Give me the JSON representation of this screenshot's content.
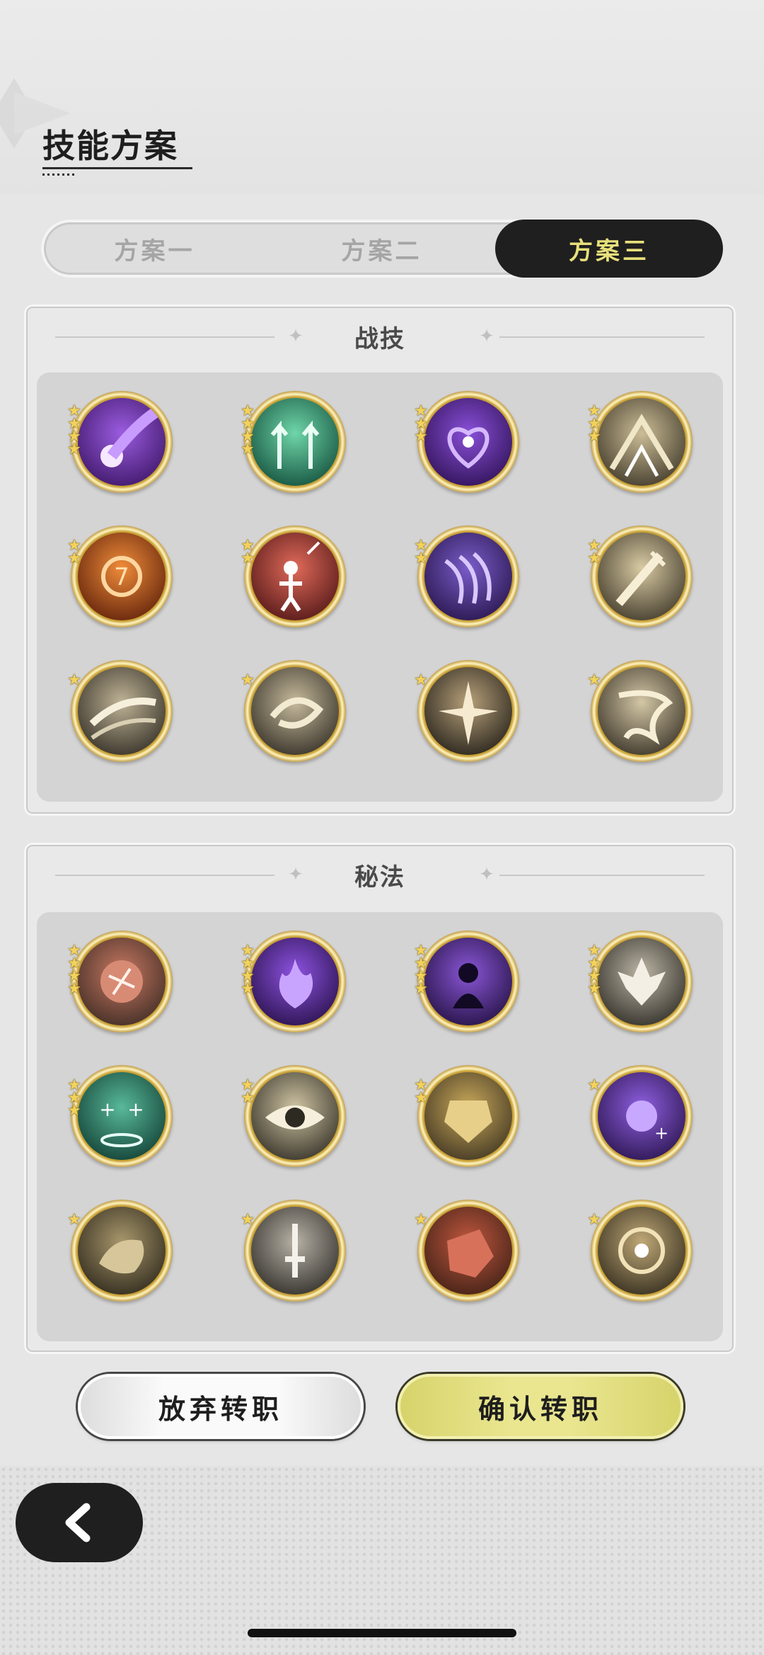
{
  "header": {
    "title": "技能方案"
  },
  "tabs": [
    {
      "label": "方案一",
      "active": false
    },
    {
      "label": "方案二",
      "active": false
    },
    {
      "label": "方案三",
      "active": true
    }
  ],
  "combat_section": {
    "title": "战技",
    "skills": [
      {
        "icon": "purple-comet-skill-icon",
        "stars": 4
      },
      {
        "icon": "green-arrows-up-skill-icon",
        "stars": 4
      },
      {
        "icon": "purple-heart-burst-skill-icon",
        "stars": 3
      },
      {
        "icon": "golden-rays-skill-icon",
        "stars": 3
      },
      {
        "icon": "fire-seal-skill-icon",
        "stars": 2
      },
      {
        "icon": "red-figure-sword-skill-icon",
        "stars": 2
      },
      {
        "icon": "purple-claw-skill-icon",
        "stars": 2
      },
      {
        "icon": "golden-sword-skill-icon",
        "stars": 2
      },
      {
        "icon": "slash-skill-icon",
        "stars": 1
      },
      {
        "icon": "whirlwind-skill-icon",
        "stars": 1
      },
      {
        "icon": "explosion-skill-icon",
        "stars": 1
      },
      {
        "icon": "tornado-skill-icon",
        "stars": 1
      }
    ]
  },
  "secret_section": {
    "title": "秘法",
    "skills": [
      {
        "icon": "red-rune-secret-icon",
        "stars": 4
      },
      {
        "icon": "purple-flame-secret-icon",
        "stars": 4
      },
      {
        "icon": "purple-figure-secret-icon",
        "stars": 4
      },
      {
        "icon": "silver-leaf-secret-icon",
        "stars": 4
      },
      {
        "icon": "green-heal-secret-icon",
        "stars": 3
      },
      {
        "icon": "eye-secret-icon",
        "stars": 2
      },
      {
        "icon": "golden-armor-secret-icon",
        "stars": 2
      },
      {
        "icon": "purple-orb-secret-icon",
        "stars": 1
      },
      {
        "icon": "bronze-beast-secret-icon",
        "stars": 1
      },
      {
        "icon": "silver-sword-secret-icon",
        "stars": 1
      },
      {
        "icon": "red-rock-secret-icon",
        "stars": 1
      },
      {
        "icon": "golden-spiral-secret-icon",
        "stars": 1
      }
    ]
  },
  "actions": {
    "cancel_label": "放弃转职",
    "confirm_label": "确认转职"
  },
  "nav": {
    "back_icon": "chevron-left-icon"
  },
  "colors": {
    "accent_yellow": "#e8e07a",
    "confirm_button": "#eae690",
    "tab_active_bg": "#1f1f1f"
  }
}
